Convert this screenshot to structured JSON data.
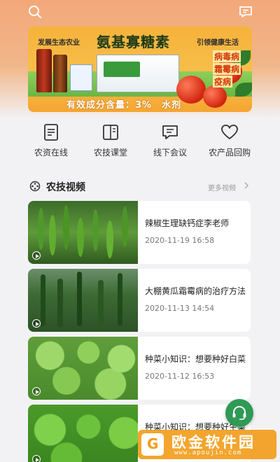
{
  "banner": {
    "tag_left": "发展生态农业",
    "title": "氨基寡糖素",
    "tag_right": "引领健康生活",
    "diseases": [
      "病毒病",
      "霜霉病",
      "疫病"
    ],
    "slogan": "有效成分含量：3%　水剂"
  },
  "quick_nav": [
    {
      "label": "农资在线",
      "icon": "document-icon"
    },
    {
      "label": "农技课堂",
      "icon": "book-icon"
    },
    {
      "label": "线下会议",
      "icon": "chat-icon"
    },
    {
      "label": "农产品回购",
      "icon": "heart-icon"
    }
  ],
  "section": {
    "title": "农技视频",
    "more_label": "更多视频"
  },
  "videos": [
    {
      "title": "辣椒生理缺钙症李老师",
      "date": "2020-11-19 16:58"
    },
    {
      "title": "大棚黄瓜霜霉病的治疗方法",
      "date": "2020-11-13 14:54"
    },
    {
      "title": "种菜小知识：想要种好白菜",
      "date": "2020-11-12 16:53"
    },
    {
      "title": "种菜小知识：想要种好生菜",
      "date": ""
    }
  ],
  "watermark": {
    "name": "欧金软件园",
    "url": "www.apoujin.com",
    "logo_char": "G"
  },
  "colors": {
    "header": "#f3a87a",
    "accent_green": "#2e9a55",
    "watermark": "#f29e1e"
  }
}
